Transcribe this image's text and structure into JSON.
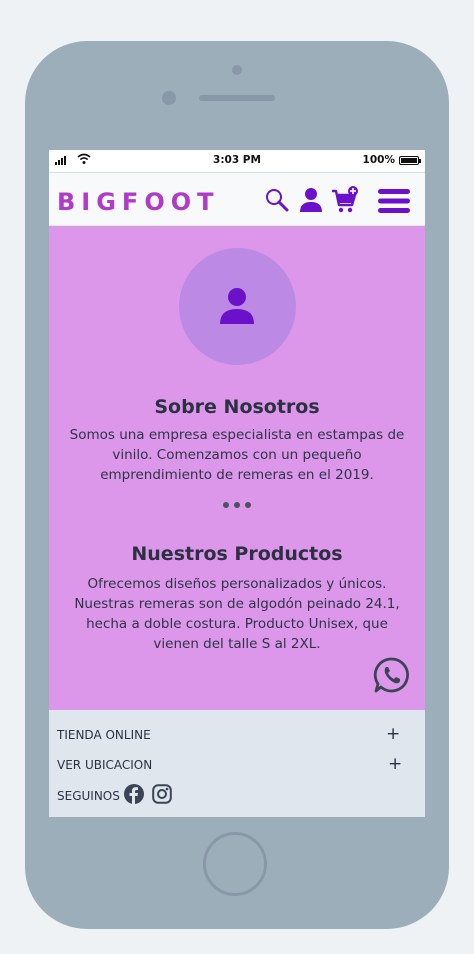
{
  "status_bar": {
    "time": "3:03 PM",
    "battery": "100%"
  },
  "navbar": {
    "brand": "BIGFOOT",
    "icons": [
      "search-icon",
      "user-icon",
      "cart-add-icon",
      "menu-icon"
    ],
    "accent_color": "#b13ac8",
    "icon_color": "#6a11c9"
  },
  "about": {
    "title": "Sobre Nosotros",
    "text": "Somos una empresa especialista en estampas de vinilo. Comenzamos con un pequeño emprendimiento de remeras en el 2019."
  },
  "products": {
    "title": "Nuestros Productos",
    "text": "Ofrecemos diseños personalizados y únicos. Nuestras remeras son de algodón peinado 24.1, hecha a doble costura. Producto Unisex, que vienen del talle S al 2XL."
  },
  "footer": {
    "items": [
      {
        "label": "TIENDA ONLINE",
        "action": "+"
      },
      {
        "label": "VER UBICACION",
        "action": "+"
      }
    ],
    "social_label": "SEGUINOS",
    "social_icons": [
      "facebook-icon",
      "instagram-icon"
    ]
  },
  "colors": {
    "main_bg": "#dc97eb",
    "avatar_bg": "#bc8ae4",
    "footer_bg": "#dfe6ee",
    "phone_frame": "#9daebb"
  }
}
